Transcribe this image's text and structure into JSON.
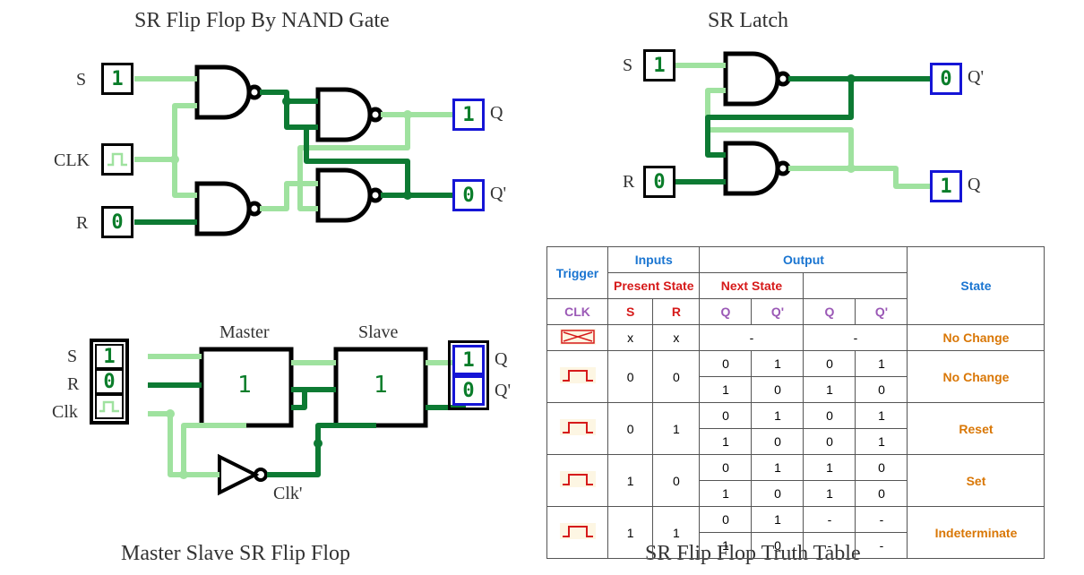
{
  "titles": {
    "nand": "SR Flip Flop By NAND Gate",
    "latch": "SR Latch",
    "ms": "Master Slave SR Flip Flop",
    "truth": "SR Flip Flop Truth Table"
  },
  "nand": {
    "S_label": "S",
    "S_val": "1",
    "R_label": "R",
    "R_val": "0",
    "CLK_label": "CLK",
    "Q_label": "Q",
    "Q_val": "1",
    "Qb_label": "Q'",
    "Qb_val": "0"
  },
  "latch": {
    "S_label": "S",
    "S_val": "1",
    "R_label": "R",
    "R_val": "0",
    "Q_label": "Q",
    "Q_val": "1",
    "Qb_label": "Q'",
    "Qb_val": "0"
  },
  "ms": {
    "S_label": "S",
    "S_val": "1",
    "R_label": "R",
    "R_val": "0",
    "Clk_label": "Clk",
    "Master_label": "Master",
    "Master_val": "1",
    "Slave_label": "Slave",
    "Slave_val": "1",
    "Q_label": "Q",
    "Q_val": "1",
    "Qb_label": "Q'",
    "Qb_val": "0",
    "Clkb_label": "Clk'"
  },
  "truth_table": {
    "headers": {
      "trigger": "Trigger",
      "inputs": "Inputs",
      "output": "Output",
      "present": "Present State",
      "next": "Next State",
      "state": "State",
      "clk": "CLK",
      "s": "S",
      "r": "R",
      "q": "Q",
      "qb": "Q'"
    },
    "rows": [
      {
        "clk": "none",
        "s": "x",
        "r": "x",
        "pq": [
          "-"
        ],
        "pqb": [
          ""
        ],
        "nq": [
          "-"
        ],
        "nqb": [
          ""
        ],
        "state": "No Change",
        "span": 1
      },
      {
        "clk": "pulse",
        "s": "0",
        "r": "0",
        "pq": [
          "0",
          "1"
        ],
        "pqb": [
          "1",
          "0"
        ],
        "nq": [
          "0",
          "1"
        ],
        "nqb": [
          "1",
          "0"
        ],
        "state": "No Change",
        "span": 2
      },
      {
        "clk": "pulse",
        "s": "0",
        "r": "1",
        "pq": [
          "0",
          "1"
        ],
        "pqb": [
          "1",
          "0"
        ],
        "nq": [
          "0",
          "0"
        ],
        "nqb": [
          "1",
          "1"
        ],
        "state": "Reset",
        "span": 2
      },
      {
        "clk": "pulse",
        "s": "1",
        "r": "0",
        "pq": [
          "0",
          "1"
        ],
        "pqb": [
          "1",
          "0"
        ],
        "nq": [
          "1",
          "1"
        ],
        "nqb": [
          "0",
          "0"
        ],
        "state": "Set",
        "span": 2
      },
      {
        "clk": "pulse",
        "s": "1",
        "r": "1",
        "pq": [
          "0",
          "1"
        ],
        "pqb": [
          "1",
          "0"
        ],
        "nq": [
          "-",
          "-"
        ],
        "nqb": [
          "-",
          "-"
        ],
        "state": "Indeterminate",
        "span": 2
      }
    ]
  }
}
